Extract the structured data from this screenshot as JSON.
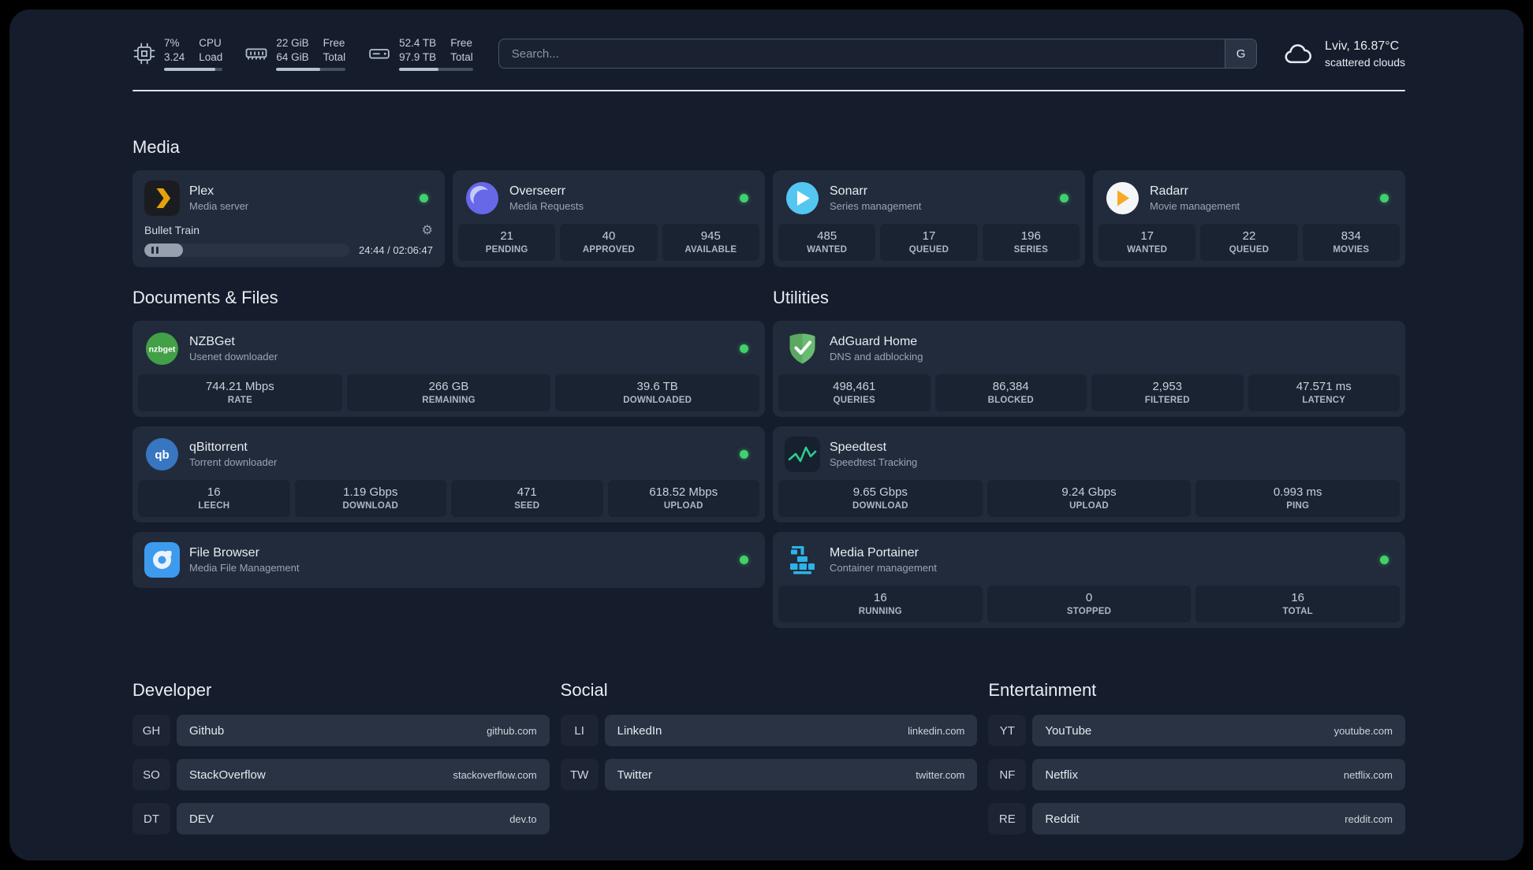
{
  "topbar": {
    "cpu": {
      "value1": "7%",
      "label1": "CPU",
      "value2": "3.24",
      "label2": "Load",
      "progress": 87
    },
    "memory": {
      "value1": "22 GiB",
      "label1": "Free",
      "value2": "64 GiB",
      "label2": "Total",
      "progress": 63
    },
    "disk": {
      "value1": "52.4 TB",
      "label1": "Free",
      "value2": "97.9 TB",
      "label2": "Total",
      "progress": 53
    },
    "search": {
      "placeholder": "Search...",
      "provider_label": "G"
    },
    "weather": {
      "location": "Lviv, 16.87°C",
      "condition": "scattered clouds"
    }
  },
  "sections": {
    "media": {
      "title": "Media",
      "cards": [
        {
          "name": "Plex",
          "subtitle": "Media server",
          "status": "online",
          "player": {
            "title": "Bullet Train",
            "time": "24:44 / 02:06:47",
            "progress": 19
          }
        },
        {
          "name": "Overseerr",
          "subtitle": "Media Requests",
          "status": "online",
          "stats": [
            {
              "value": "21",
              "label": "PENDING"
            },
            {
              "value": "40",
              "label": "APPROVED"
            },
            {
              "value": "945",
              "label": "AVAILABLE"
            }
          ]
        },
        {
          "name": "Sonarr",
          "subtitle": "Series management",
          "status": "online",
          "stats": [
            {
              "value": "485",
              "label": "WANTED"
            },
            {
              "value": "17",
              "label": "QUEUED"
            },
            {
              "value": "196",
              "label": "SERIES"
            }
          ]
        },
        {
          "name": "Radarr",
          "subtitle": "Movie management",
          "status": "online",
          "stats": [
            {
              "value": "17",
              "label": "WANTED"
            },
            {
              "value": "22",
              "label": "QUEUED"
            },
            {
              "value": "834",
              "label": "MOVIES"
            }
          ]
        }
      ]
    },
    "documents": {
      "title": "Documents & Files",
      "cards": [
        {
          "name": "NZBGet",
          "subtitle": "Usenet downloader",
          "status": "online",
          "stats": [
            {
              "value": "744.21 Mbps",
              "label": "RATE"
            },
            {
              "value": "266 GB",
              "label": "REMAINING"
            },
            {
              "value": "39.6 TB",
              "label": "DOWNLOADED"
            }
          ]
        },
        {
          "name": "qBittorrent",
          "subtitle": "Torrent downloader",
          "status": "online",
          "stats": [
            {
              "value": "16",
              "label": "LEECH"
            },
            {
              "value": "1.19 Gbps",
              "label": "DOWNLOAD"
            },
            {
              "value": "471",
              "label": "SEED"
            },
            {
              "value": "618.52 Mbps",
              "label": "UPLOAD"
            }
          ]
        },
        {
          "name": "File Browser",
          "subtitle": "Media File Management",
          "status": "online"
        }
      ]
    },
    "utilities": {
      "title": "Utilities",
      "cards": [
        {
          "name": "AdGuard Home",
          "subtitle": "DNS and adblocking",
          "stats": [
            {
              "value": "498,461",
              "label": "QUERIES"
            },
            {
              "value": "86,384",
              "label": "BLOCKED"
            },
            {
              "value": "2,953",
              "label": "FILTERED"
            },
            {
              "value": "47.571 ms",
              "label": "LATENCY"
            }
          ]
        },
        {
          "name": "Speedtest",
          "subtitle": "Speedtest Tracking",
          "stats": [
            {
              "value": "9.65 Gbps",
              "label": "DOWNLOAD"
            },
            {
              "value": "9.24 Gbps",
              "label": "UPLOAD"
            },
            {
              "value": "0.993 ms",
              "label": "PING"
            }
          ]
        },
        {
          "name": "Media Portainer",
          "subtitle": "Container management",
          "status": "online",
          "stats": [
            {
              "value": "16",
              "label": "RUNNING"
            },
            {
              "value": "0",
              "label": "STOPPED"
            },
            {
              "value": "16",
              "label": "TOTAL"
            }
          ]
        }
      ]
    },
    "bookmarks": [
      {
        "title": "Developer",
        "items": [
          {
            "abbr": "GH",
            "name": "Github",
            "url": "github.com"
          },
          {
            "abbr": "SO",
            "name": "StackOverflow",
            "url": "stackoverflow.com"
          },
          {
            "abbr": "DT",
            "name": "DEV",
            "url": "dev.to"
          }
        ]
      },
      {
        "title": "Social",
        "items": [
          {
            "abbr": "LI",
            "name": "LinkedIn",
            "url": "linkedin.com"
          },
          {
            "abbr": "TW",
            "name": "Twitter",
            "url": "twitter.com"
          }
        ]
      },
      {
        "title": "Entertainment",
        "items": [
          {
            "abbr": "YT",
            "name": "YouTube",
            "url": "youtube.com"
          },
          {
            "abbr": "NF",
            "name": "Netflix",
            "url": "netflix.com"
          },
          {
            "abbr": "RE",
            "name": "Reddit",
            "url": "reddit.com"
          }
        ]
      }
    ]
  },
  "colors": {
    "status_online": "#41d06c",
    "accent_amber": "#e5a00d",
    "panel_bg": "#151c2b"
  }
}
